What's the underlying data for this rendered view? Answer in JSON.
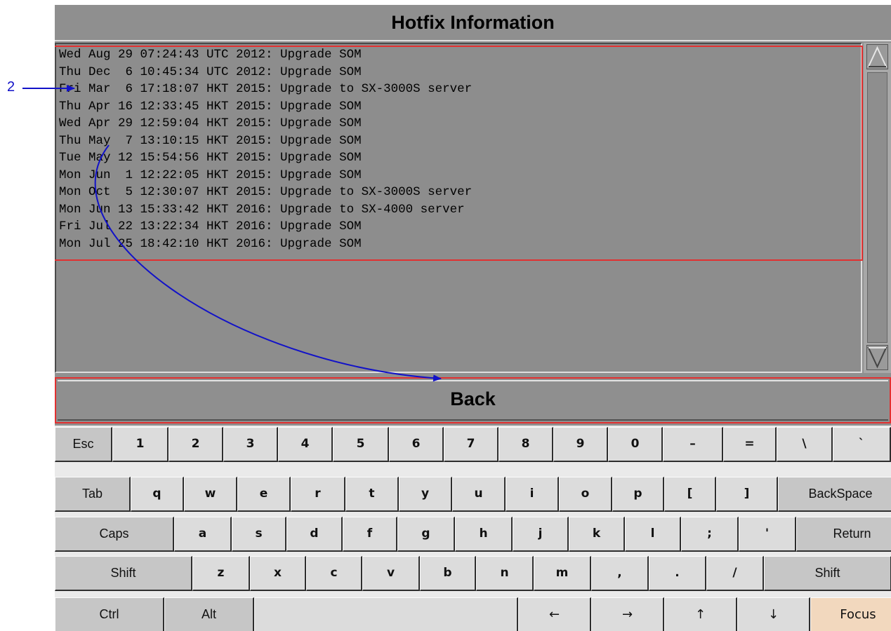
{
  "window": {
    "title": "Hotfix Information"
  },
  "log": {
    "lines": [
      "Wed Aug 29 07:24:43 UTC 2012: Upgrade SOM",
      "Thu Dec  6 10:45:34 UTC 2012: Upgrade SOM",
      "Fri Mar  6 17:18:07 HKT 2015: Upgrade to SX-3000S server",
      "Thu Apr 16 12:33:45 HKT 2015: Upgrade SOM",
      "Wed Apr 29 12:59:04 HKT 2015: Upgrade SOM",
      "Thu May  7 13:10:15 HKT 2015: Upgrade SOM",
      "Tue May 12 15:54:56 HKT 2015: Upgrade SOM",
      "Mon Jun  1 12:22:05 HKT 2015: Upgrade SOM",
      "Mon Oct  5 12:30:07 HKT 2015: Upgrade to SX-3000S server",
      "Mon Jun 13 15:33:42 HKT 2016: Upgrade to SX-4000 server",
      "Fri Jul 22 13:22:34 HKT 2016: Upgrade SOM",
      "Mon Jul 25 18:42:10 HKT 2016: Upgrade SOM"
    ]
  },
  "buttons": {
    "back": "Back"
  },
  "callout": {
    "number": "2",
    "color": "#1212c8",
    "highlight_color": "#e23030"
  },
  "keyboard": {
    "rows": [
      [
        {
          "label": "Esc",
          "name": "key-esc",
          "style": "mod"
        },
        {
          "label": "1",
          "name": "key-1",
          "style": "bold"
        },
        {
          "label": "2",
          "name": "key-2",
          "style": "bold"
        },
        {
          "label": "3",
          "name": "key-3",
          "style": "bold"
        },
        {
          "label": "4",
          "name": "key-4",
          "style": "bold"
        },
        {
          "label": "5",
          "name": "key-5",
          "style": "bold"
        },
        {
          "label": "6",
          "name": "key-6",
          "style": "bold"
        },
        {
          "label": "7",
          "name": "key-7",
          "style": "bold"
        },
        {
          "label": "8",
          "name": "key-8",
          "style": "bold"
        },
        {
          "label": "9",
          "name": "key-9",
          "style": "bold"
        },
        {
          "label": "0",
          "name": "key-0",
          "style": "bold"
        },
        {
          "label": "–",
          "name": "key-minus",
          "style": "bold"
        },
        {
          "label": "=",
          "name": "key-equals",
          "style": "bold"
        },
        {
          "label": "\\",
          "name": "key-backslash",
          "style": "bold"
        },
        {
          "label": "`",
          "name": "key-backtick",
          "style": "bold"
        }
      ],
      [
        {
          "label": "Tab",
          "name": "key-tab",
          "style": "mod"
        },
        {
          "label": "q",
          "name": "key-q",
          "style": "bold"
        },
        {
          "label": "w",
          "name": "key-w",
          "style": "bold"
        },
        {
          "label": "e",
          "name": "key-e",
          "style": "bold"
        },
        {
          "label": "r",
          "name": "key-r",
          "style": "bold"
        },
        {
          "label": "t",
          "name": "key-t",
          "style": "bold"
        },
        {
          "label": "y",
          "name": "key-y",
          "style": "bold"
        },
        {
          "label": "u",
          "name": "key-u",
          "style": "bold"
        },
        {
          "label": "i",
          "name": "key-i",
          "style": "bold"
        },
        {
          "label": "o",
          "name": "key-o",
          "style": "bold"
        },
        {
          "label": "p",
          "name": "key-p",
          "style": "bold"
        },
        {
          "label": "[",
          "name": "key-left-bracket",
          "style": "bold"
        },
        {
          "label": "]",
          "name": "key-right-bracket",
          "style": "bold"
        },
        {
          "label": "BackSpace",
          "name": "key-backspace",
          "style": "mod"
        }
      ],
      [
        {
          "label": "Caps",
          "name": "key-caps",
          "style": "mod"
        },
        {
          "label": "a",
          "name": "key-a",
          "style": "bold"
        },
        {
          "label": "s",
          "name": "key-s",
          "style": "bold"
        },
        {
          "label": "d",
          "name": "key-d",
          "style": "bold"
        },
        {
          "label": "f",
          "name": "key-f",
          "style": "bold"
        },
        {
          "label": "g",
          "name": "key-g",
          "style": "bold"
        },
        {
          "label": "h",
          "name": "key-h",
          "style": "bold"
        },
        {
          "label": "j",
          "name": "key-j",
          "style": "bold"
        },
        {
          "label": "k",
          "name": "key-k",
          "style": "bold"
        },
        {
          "label": "l",
          "name": "key-l",
          "style": "bold"
        },
        {
          "label": ";",
          "name": "key-semicolon",
          "style": "bold"
        },
        {
          "label": "'",
          "name": "key-apostrophe",
          "style": "bold"
        },
        {
          "label": "Return",
          "name": "key-return",
          "style": "mod"
        }
      ],
      [
        {
          "label": "Shift",
          "name": "key-shift-left",
          "style": "mod"
        },
        {
          "label": "z",
          "name": "key-z",
          "style": "bold"
        },
        {
          "label": "x",
          "name": "key-x",
          "style": "bold"
        },
        {
          "label": "c",
          "name": "key-c",
          "style": "bold"
        },
        {
          "label": "v",
          "name": "key-v",
          "style": "bold"
        },
        {
          "label": "b",
          "name": "key-b",
          "style": "bold"
        },
        {
          "label": "n",
          "name": "key-n",
          "style": "bold"
        },
        {
          "label": "m",
          "name": "key-m",
          "style": "bold"
        },
        {
          "label": ",",
          "name": "key-comma",
          "style": "bold"
        },
        {
          "label": ".",
          "name": "key-period",
          "style": "bold"
        },
        {
          "label": "/",
          "name": "key-slash",
          "style": "bold"
        },
        {
          "label": "Shift",
          "name": "key-shift-right",
          "style": "mod"
        }
      ],
      [
        {
          "label": "Ctrl",
          "name": "key-ctrl",
          "style": "mod"
        },
        {
          "label": "Alt",
          "name": "key-alt",
          "style": "mod"
        },
        {
          "label": "",
          "name": "key-space",
          "style": "plain"
        },
        {
          "label": "←",
          "name": "key-arrow-left",
          "style": "plain"
        },
        {
          "label": "→",
          "name": "key-arrow-right",
          "style": "plain"
        },
        {
          "label": "↑",
          "name": "key-arrow-up",
          "style": "plain"
        },
        {
          "label": "↓",
          "name": "key-arrow-down",
          "style": "plain"
        },
        {
          "label": "Focus",
          "name": "key-focus",
          "style": "focus"
        }
      ]
    ]
  }
}
